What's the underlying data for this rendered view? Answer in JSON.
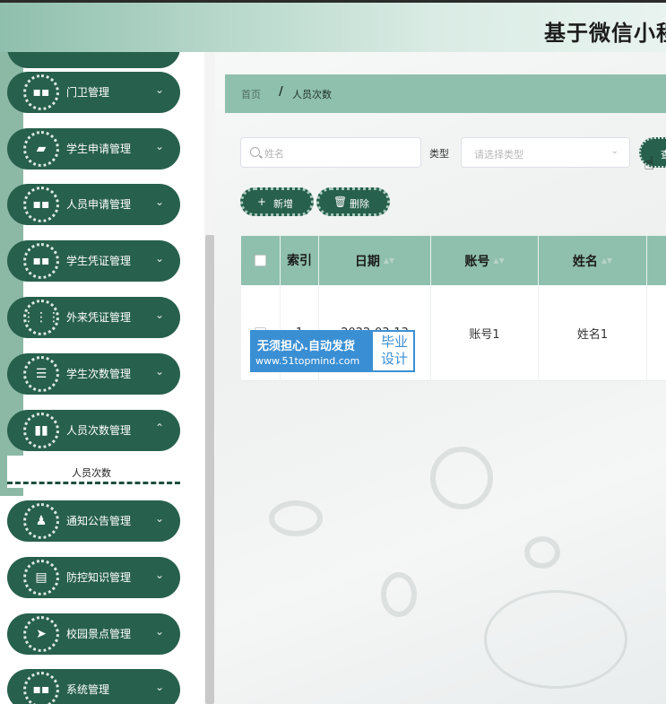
{
  "header": {
    "title": "基于微信小程"
  },
  "sidebar": {
    "items": [
      {
        "label": "门卫管理",
        "icon": "grid-icon"
      },
      {
        "label": "学生申请管理",
        "icon": "camera-icon"
      },
      {
        "label": "人员申请管理",
        "icon": "grid-icon"
      },
      {
        "label": "学生凭证管理",
        "icon": "grid-icon"
      },
      {
        "label": "外来凭证管理",
        "icon": "apps-icon"
      },
      {
        "label": "学生次数管理",
        "icon": "sliders-icon"
      },
      {
        "label": "人员次数管理",
        "icon": "chart-icon"
      },
      {
        "label": "通知公告管理",
        "icon": "stamp-icon"
      },
      {
        "label": "防控知识管理",
        "icon": "clipboard-icon"
      },
      {
        "label": "校园景点管理",
        "icon": "send-icon"
      },
      {
        "label": "系统管理",
        "icon": "grid-icon"
      }
    ],
    "sub_item": "人员次数"
  },
  "breadcrumb": {
    "home": "首页",
    "separator": "/",
    "current": "人员次数"
  },
  "search": {
    "name_placeholder": "姓名",
    "type_label": "类型",
    "type_placeholder": "请选择类型",
    "query_label": "查"
  },
  "actions": {
    "add_label": "新增",
    "delete_label": "删除"
  },
  "table": {
    "columns": [
      "索引",
      "日期",
      "账号",
      "姓名"
    ],
    "rows": [
      {
        "index": "1",
        "date": "2022-03-13",
        "account": "账号1",
        "name": "姓名1"
      }
    ]
  },
  "watermark": {
    "line1": "无须担心.自动发货",
    "line2": "www.51topmind.com",
    "right_line1": "毕业",
    "right_line2": "设计"
  },
  "colors": {
    "menu_bg": "#27604c",
    "accent": "#8fc0ad",
    "watermark_blue": "#3a8fd4"
  }
}
